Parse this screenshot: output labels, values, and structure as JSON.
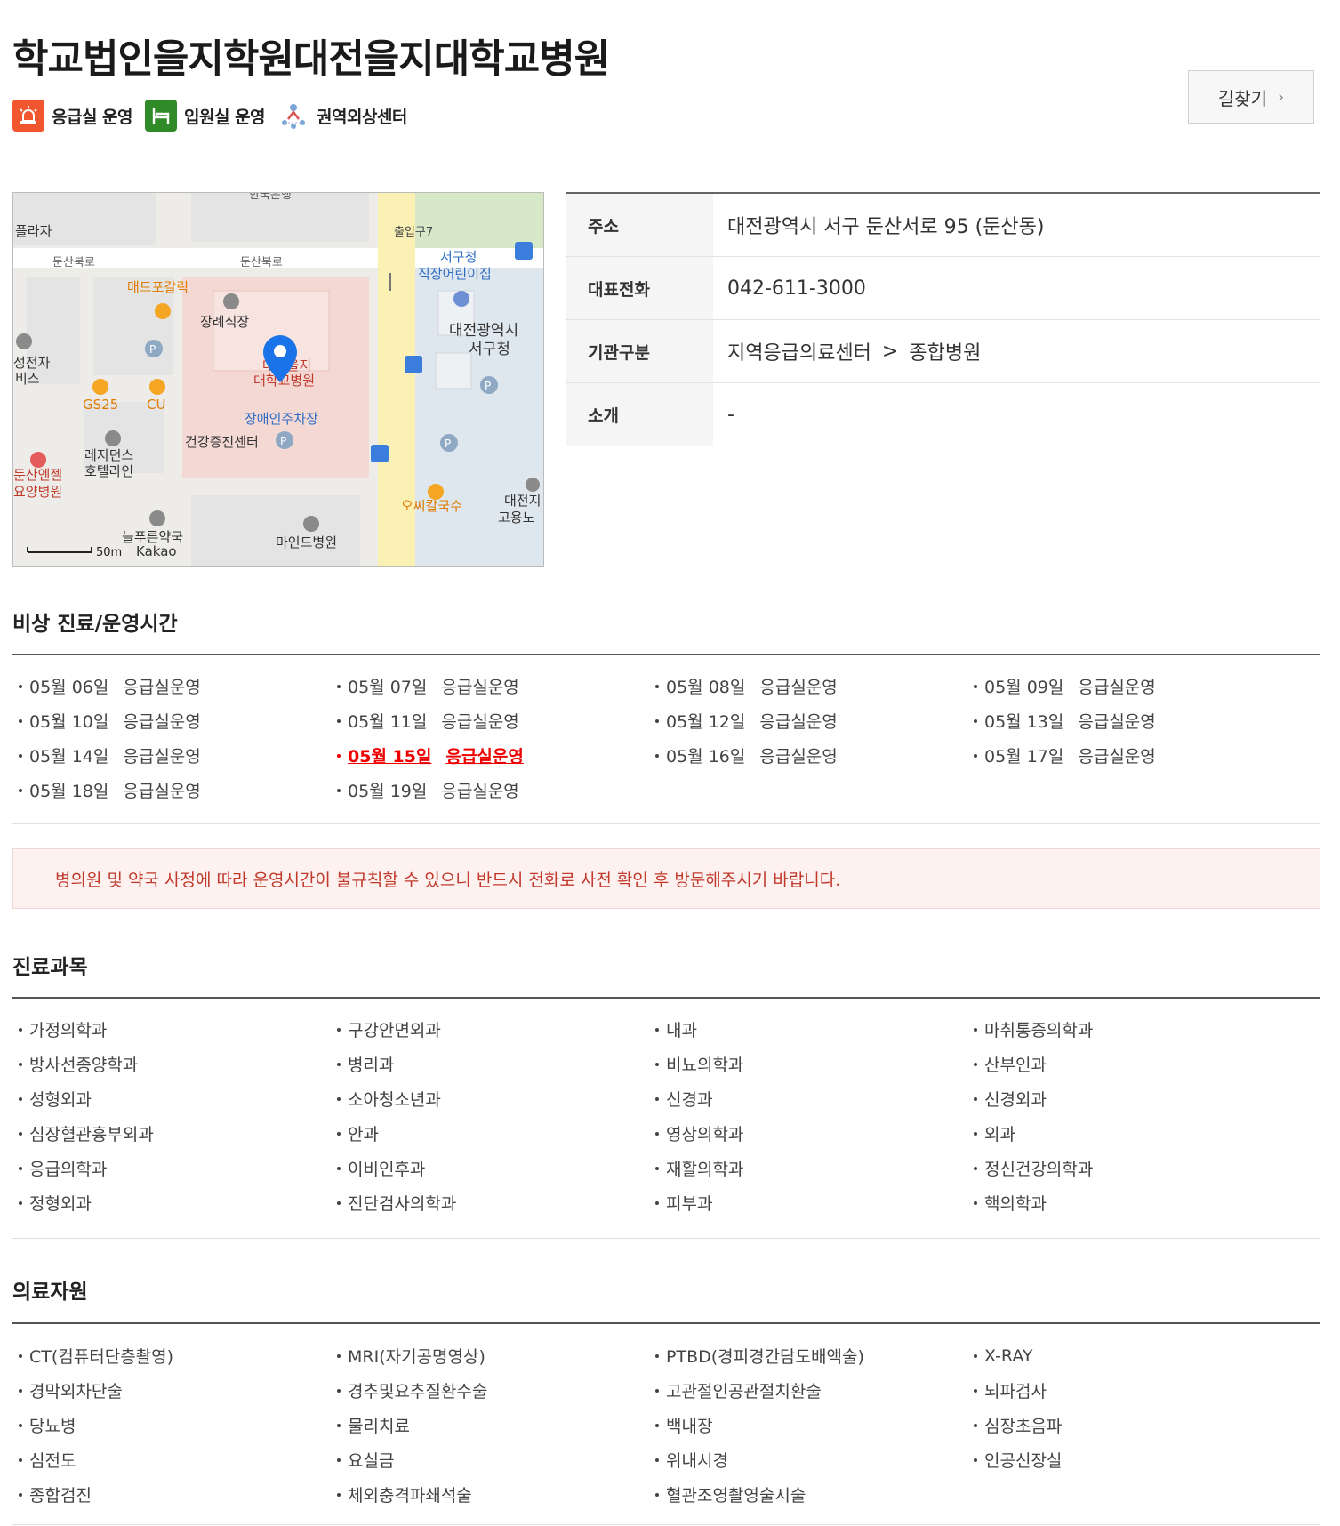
{
  "hospital": {
    "name": "학교법인을지학원대전을지대학교병원",
    "badges": [
      {
        "icon": "ambulance-siren-icon",
        "label": "응급실 운영",
        "color": "#f1562e"
      },
      {
        "icon": "bed-icon",
        "label": "입원실 운영",
        "color": "#2f8a27"
      },
      {
        "icon": "trauma-center-icon",
        "label": "권역외상센터"
      }
    ],
    "route_button": "길찾기",
    "route_icon": "chevron-right-icon"
  },
  "map": {
    "labels": {
      "top_road": "한국은행",
      "plaza": "플라자",
      "road1": "둔산북로",
      "road2": "둔산북로",
      "gate": "출입구7",
      "daycare1": "서구청",
      "daycare2": "직장어린이집",
      "madpo": "매드포갈릭",
      "funeral": "장례식장",
      "office1": "대전광역시",
      "office2": "서구청",
      "elec1": "성전자",
      "elec2": "비스",
      "hospital1": "대전을지",
      "hospital2": "대학교병원",
      "gs25": "GS25",
      "cu": "CU",
      "parking": "장애인주차장",
      "residence1": "레지던스",
      "residence2": "호텔라인",
      "health": "건강증진센터",
      "nursing1": "둔산엔젤",
      "nursing2": "요양병원",
      "kalguksu": "오씨칼국수",
      "daejeon1": "대전지",
      "daejeon2": "고용노",
      "pharmacy": "늘푸른약국",
      "mind": "마인드병원",
      "scale": "50m",
      "kakao": "Kakao"
    }
  },
  "info": {
    "rows": [
      {
        "key": "주소",
        "value": "대전광역시 서구 둔산서로 95 (둔산동)"
      },
      {
        "key": "대표전화",
        "value": "042-611-3000"
      },
      {
        "key": "기관구분",
        "value_a": "지역응급의료센터",
        "sep": ">",
        "value_b": "종합병원"
      },
      {
        "key": "소개",
        "value": "-"
      }
    ]
  },
  "schedule": {
    "title": "비상 진료/운영시간",
    "items": [
      {
        "date": "05월 06일",
        "status": "응급실운영"
      },
      {
        "date": "05월 07일",
        "status": "응급실운영"
      },
      {
        "date": "05월 08일",
        "status": "응급실운영"
      },
      {
        "date": "05월 09일",
        "status": "응급실운영"
      },
      {
        "date": "05월 10일",
        "status": "응급실운영"
      },
      {
        "date": "05월 11일",
        "status": "응급실운영"
      },
      {
        "date": "05월 12일",
        "status": "응급실운영"
      },
      {
        "date": "05월 13일",
        "status": "응급실운영"
      },
      {
        "date": "05월 14일",
        "status": "응급실운영"
      },
      {
        "date": "05월 15일",
        "status": "응급실운영",
        "highlight": true
      },
      {
        "date": "05월 16일",
        "status": "응급실운영"
      },
      {
        "date": "05월 17일",
        "status": "응급실운영"
      },
      {
        "date": "05월 18일",
        "status": "응급실운영"
      },
      {
        "date": "05월 19일",
        "status": "응급실운영"
      }
    ],
    "highlight_color": "#e00000"
  },
  "notice": "병의원 및 약국 사정에 따라 운영시간이 불규칙할 수 있으니 반드시 전화로 사전 확인 후 방문해주시기 바랍니다.",
  "departments": {
    "title": "진료과목",
    "items": [
      "가정의학과",
      "구강안면외과",
      "내과",
      "마취통증의학과",
      "방사선종양학과",
      "병리과",
      "비뇨의학과",
      "산부인과",
      "성형외과",
      "소아청소년과",
      "신경과",
      "신경외과",
      "심장혈관흉부외과",
      "안과",
      "영상의학과",
      "외과",
      "응급의학과",
      "이비인후과",
      "재활의학과",
      "정신건강의학과",
      "정형외과",
      "진단검사의학과",
      "피부과",
      "핵의학과"
    ]
  },
  "resources": {
    "title": "의료자원",
    "items": [
      "CT(컴퓨터단층촬영)",
      "MRI(자기공명영상)",
      "PTBD(경피경간담도배액술)",
      "X-RAY",
      "경막외차단술",
      "경추및요추질환수술",
      "고관절인공관절치환술",
      "뇌파검사",
      "당뇨병",
      "물리치료",
      "백내장",
      "심장초음파",
      "심전도",
      "요실금",
      "위내시경",
      "인공신장실",
      "종합검진",
      "체외충격파쇄석술",
      "혈관조영촬영술시술"
    ]
  }
}
